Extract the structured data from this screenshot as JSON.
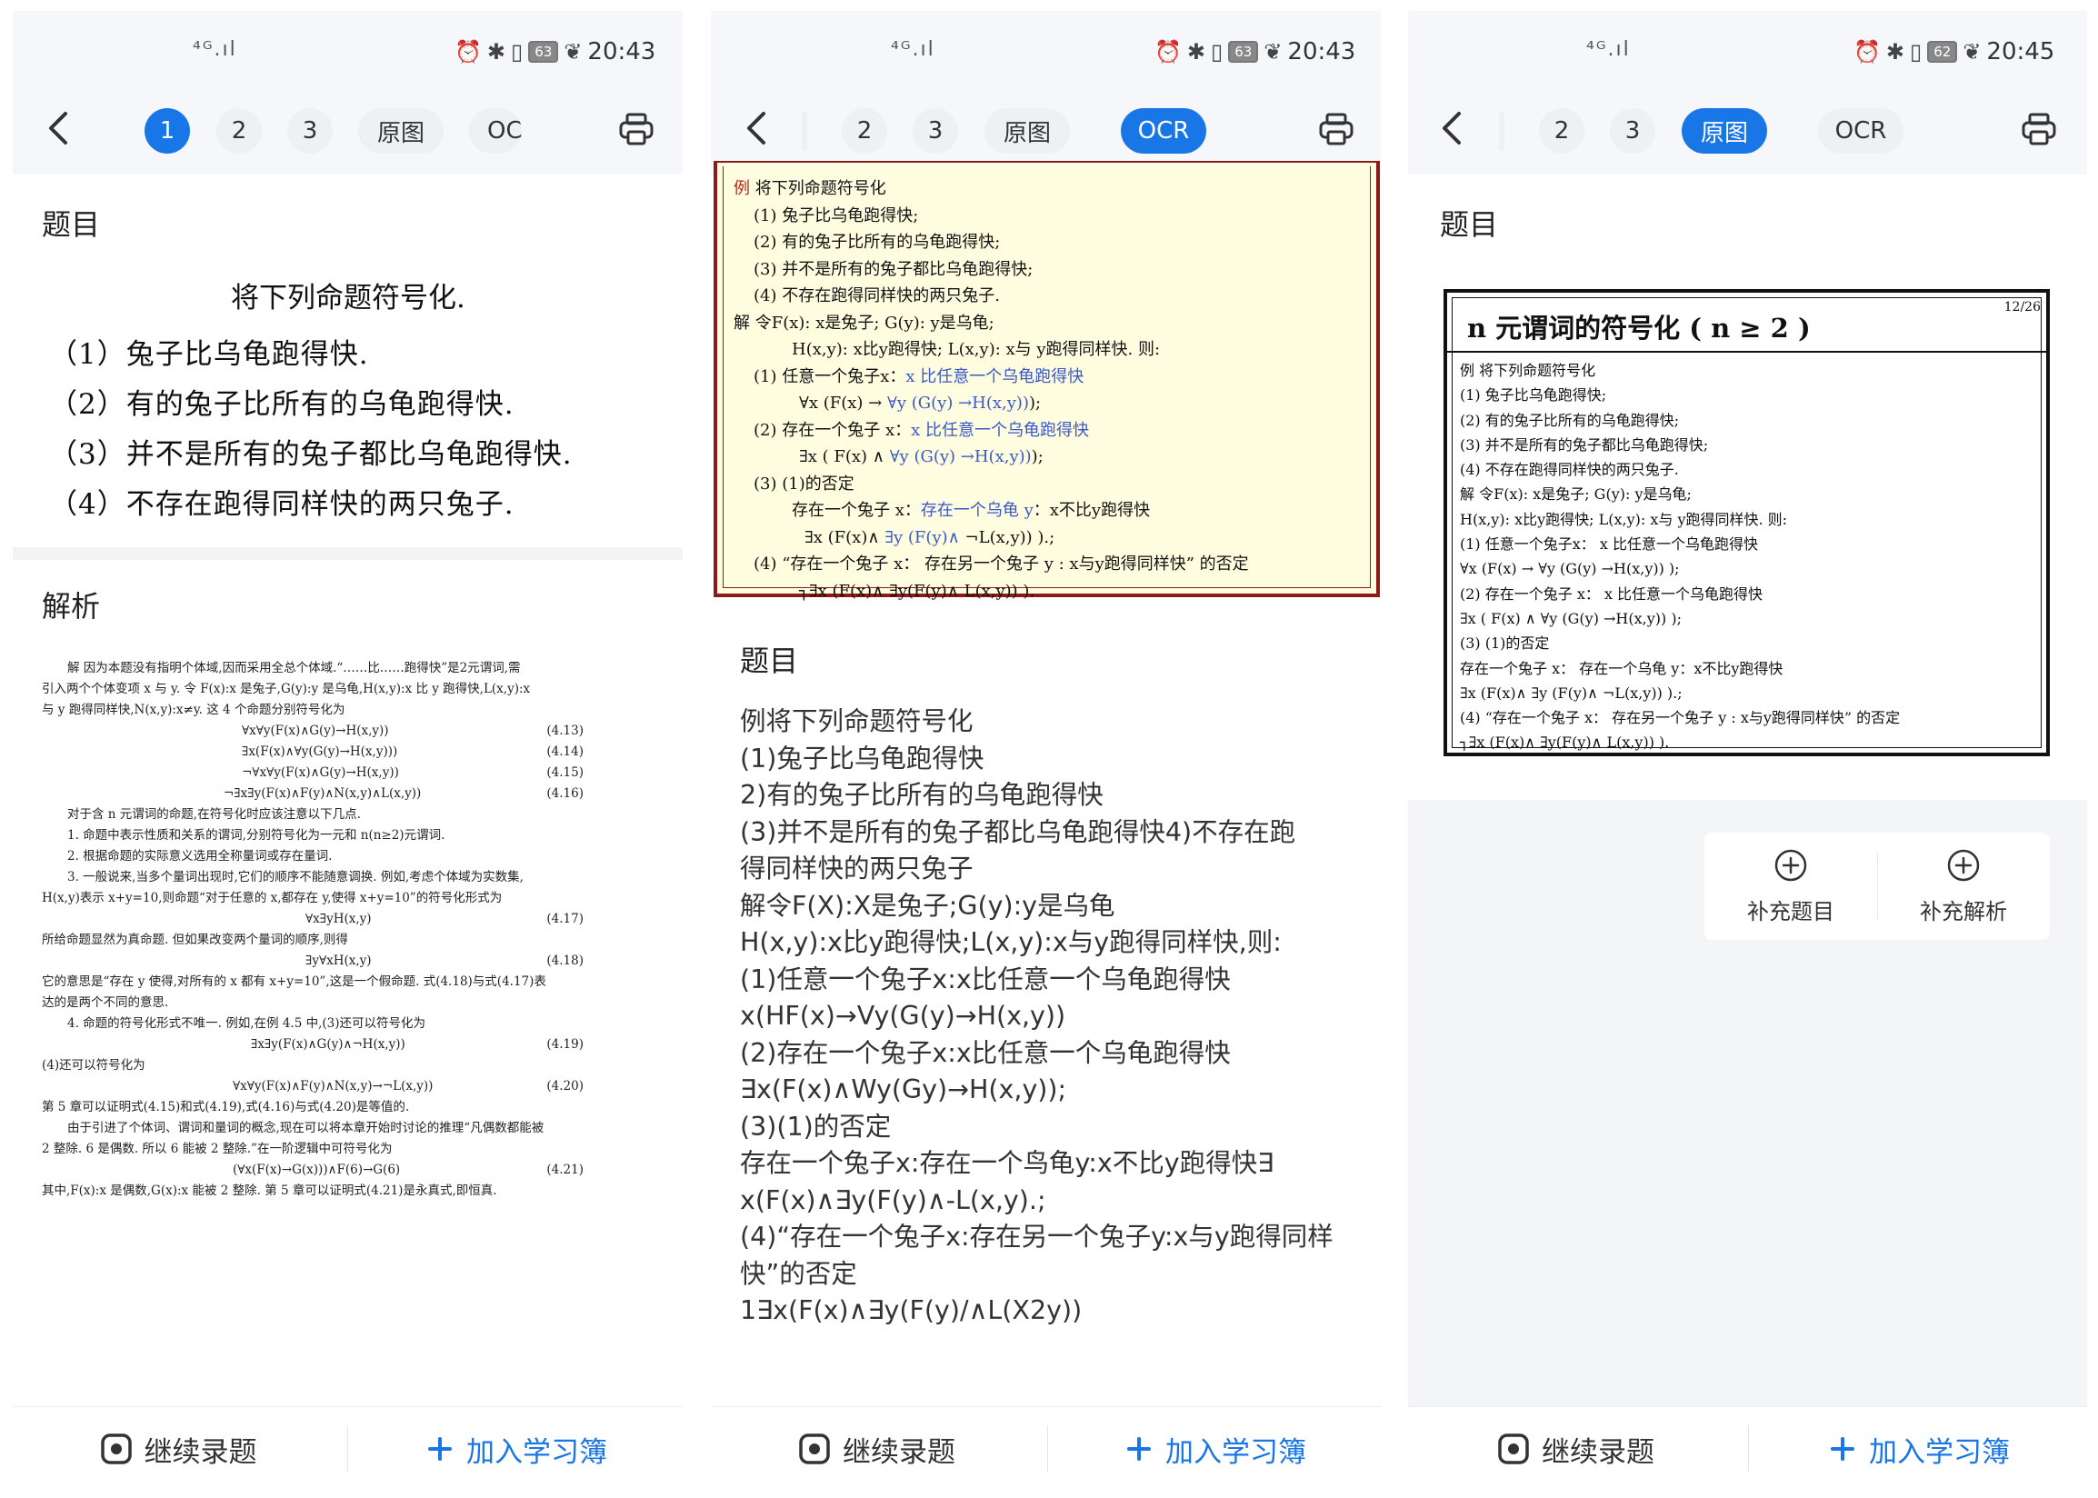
{
  "status": {
    "signal": "⁴ᴳ.ıl",
    "battery_p1": "63",
    "battery_p2": "63",
    "battery_p3": "62",
    "time_p1": "20:43",
    "time_p2": "20:43",
    "time_p3": "20:45"
  },
  "tabs": {
    "t1": "1",
    "t2": "2",
    "t3": "3",
    "original": "原图",
    "ocr": "OCR",
    "ocr_cut": "OC"
  },
  "sections": {
    "question": "题目",
    "analysis": "解析"
  },
  "question": {
    "head": "将下列命题符号化.",
    "items": [
      "（1）兔子比乌龟跑得快.",
      "（2）有的兔子比所有的乌龟跑得快.",
      "（3）并不是所有的兔子都比乌龟跑得快.",
      "（4）不存在跑得同样快的两只兔子."
    ]
  },
  "analysis_lines": [
    "解  因为本题没有指明个体域,因而采用全总个体域.“……比……跑得快”是2元谓词,需",
    "引入两个个体变项 x 与 y. 令 F(x):x 是兔子,G(y):y 是乌龟,H(x,y):x 比 y 跑得快,L(x,y):x",
    "与 y 跑得同样快,N(x,y):x≠y. 这 4 个命题分别符号化为",
    "∀x∀y(F(x)∧G(y)→H(x,y))",
    "∃x(F(x)∧∀y(G(y)→H(x,y)))",
    "¬∀x∀y(F(x)∧G(y)→H(x,y))",
    "¬∃x∃y(F(x)∧F(y)∧N(x,y)∧L(x,y))",
    "对于含 n 元谓词的命题,在符号化时应该注意以下几点.",
    "1. 命题中表示性质和关系的谓词,分别符号化为一元和 n(n≥2)元谓词.",
    "2. 根据命题的实际意义选用全称量词或存在量词.",
    "3. 一般说来,当多个量词出现时,它们的顺序不能随意调换. 例如,考虑个体域为实数集,",
    "H(x,y)表示 x+y=10,则命题“对于任意的 x,都存在 y,使得 x+y=10”的符号化形式为",
    "∀x∃yH(x,y)",
    "所给命题显然为真命题. 但如果改变两个量词的顺序,则得",
    "∃y∀xH(x,y)",
    "它的意思是“存在 y 使得,对所有的 x 都有 x+y=10”,这是一个假命题. 式(4.18)与式(4.17)表",
    "达的是两个不同的意思.",
    "4. 命题的符号化形式不唯一. 例如,在例 4.5 中,(3)还可以符号化为",
    "∃x∃y(F(x)∧G(y)∧¬H(x,y))",
    "(4)还可以符号化为",
    "∀x∀y(F(x)∧F(y)∧N(x,y)→¬L(x,y))",
    "第 5 章可以证明式(4.15)和式(4.19),式(4.16)与式(4.20)是等值的.",
    "由于引进了个体词、谓词和量词的概念,现在可以将本章开始时讨论的推理“凡偶数都能被",
    "2 整除. 6 是偶数. 所以 6 能被 2 整除.”在一阶逻辑中可符号化为",
    "(∀x(F(x)→G(x)))∧F(6)→G(6)",
    "其中,F(x):x 是偶数,G(x):x 能被 2 整除. 第 5 章可以证明式(4.21)是永真式,即恒真."
  ],
  "analysis_eqnos": [
    "(4.13)",
    "(4.14)",
    "(4.15)",
    "(4.16)",
    "(4.17)",
    "(4.18)",
    "(4.19)",
    "(4.20)",
    "(4.21)"
  ],
  "slide": {
    "l1_ex": "例",
    "l1_rest": " 将下列命题符号化",
    "l2": "(1) 兔子比乌龟跑得快;",
    "l3": "(2) 有的兔子比所有的乌龟跑得快;",
    "l4": "(3) 并不是所有的兔子都比乌龟跑得快;",
    "l5": "(4) 不存在跑得同样快的两只兔子.",
    "l6": "解 令F(x): x是兔子; G(y): y是乌龟;",
    "l7": "H(x,y): x比y跑得快; L(x,y): x与 y跑得同样快. 则:",
    "l8a": "(1) 任意一个兔子x：",
    "l8b": "x 比任意一个乌龟跑得快",
    "l9a": "∀x (F(x) →  ",
    "l9b": "∀y (G(y) →H(x,y))",
    "l9c": ");",
    "l10a": "(2) 存在一个兔子 x：",
    "l10b": "x 比任意一个乌龟跑得快",
    "l11a": "∃x ( F(x) ∧  ",
    "l11b": "∀y (G(y) →H(x,y))",
    "l11c": ");",
    "l12": "(3) (1)的否定",
    "l13a": "存在一个兔子 x：",
    "l13b": "存在一个乌龟 y",
    "l13c": "：x不比y跑得快",
    "l14a": "∃x (F(x)∧ ",
    "l14b": "∃y (F(y)∧",
    "l14c": " ¬L(x,y)) ).;",
    "l15": "(4) “存在一个兔子 x：  存在另一个兔子 y : x与y跑得同样快” 的否定",
    "l16": "┐∃x (F(x)∧  ∃y(F(y)∧  L(x,y))  )."
  },
  "ocr_lines": [
    "例将下列命题符号化",
    "(1)兔子比乌龟跑得快",
    "2)有的兔子比所有的乌龟跑得快",
    "(3)并不是所有的兔子都比乌龟跑得快4)不存在跑",
    "得同样快的两只兔子",
    "解令F(X):X是兔子;G(y):y是乌龟",
    "H(x,y):x比y跑得快;L(x,y):x与y跑得同样快,则:",
    "(1)任意一个兔子x:x比任意一个乌龟跑得快",
    "x(HF(x)→Vy(G(y)→H(x,y))",
    "(2)存在一个兔子x:x比任意一个乌龟跑得快",
    "∃x(F(x)∧Wy(Gy)→H(x,y));",
    "(3)(1)的否定",
    "存在一个兔子x:存在一个鸟龟y:x不比y跑得快∃",
    "x(F(x)∧∃y(F(y)∧-L(x,y).;",
    "(4)“存在一个兔子x:存在另一个兔子y:x与y跑得同样",
    "快”的否定",
    "1∃x(F(x)∧∃y(F(y)/∧L(X2y))"
  ],
  "orig": {
    "title": "n 元谓词的符号化 ( n ≥ 2 )",
    "page": "12/26",
    "lines": [
      "例 将下列命题符号化",
      "   (1) 兔子比乌龟跑得快;",
      "   (2) 有的兔子比所有的乌龟跑得快;",
      "   (3) 并不是所有的兔子都比乌龟跑得快;",
      "   (4) 不存在跑得同样快的两只兔子.",
      "解 令F(x): x是兔子; G(y): y是乌龟;",
      "       H(x,y): x比y跑得快; L(x,y): x与 y跑得同样快. 则:",
      "   (1)  任意一个兔子x：  x 比任意一个乌龟跑得快",
      "          ∀x (F(x) →  ∀y (G(y) →H(x,y)) );",
      "   (2)  存在一个兔子 x：  x 比任意一个乌龟跑得快",
      "          ∃x ( F(x) ∧  ∀y (G(y) →H(x,y)) );",
      "   (3)  (1)的否定",
      "        存在一个兔子 x：  存在一个乌龟 y：x不比y跑得快",
      "          ∃x (F(x)∧  ∃y (F(y)∧  ¬L(x,y)) ).;",
      "   (4) “存在一个兔子 x：  存在另一个兔子 y : x与y跑得同样快” 的否定",
      "         ┐∃x (F(x)∧  ∃y(F(y)∧  L(x,y))  )."
    ]
  },
  "supplement": {
    "question": "补充题目",
    "analysis": "补充解析"
  },
  "bottom": {
    "continue": "继续录题",
    "add": "加入学习簿",
    "continue_cut": "继续录题",
    "add_cut": "加入学习簿"
  },
  "colors": {
    "accent": "#1976e6",
    "slide_border": "#8c1a1a",
    "slide_bg": "#fffde0",
    "slide_blue": "#3a58c9"
  },
  "icons": [
    "back-arrow-icon",
    "printer-icon",
    "camera-icon",
    "plus-icon",
    "plus-circle-icon",
    "wifi-icon",
    "alarm-icon",
    "bluetooth-icon",
    "vibrate-icon",
    "leaf-icon"
  ]
}
